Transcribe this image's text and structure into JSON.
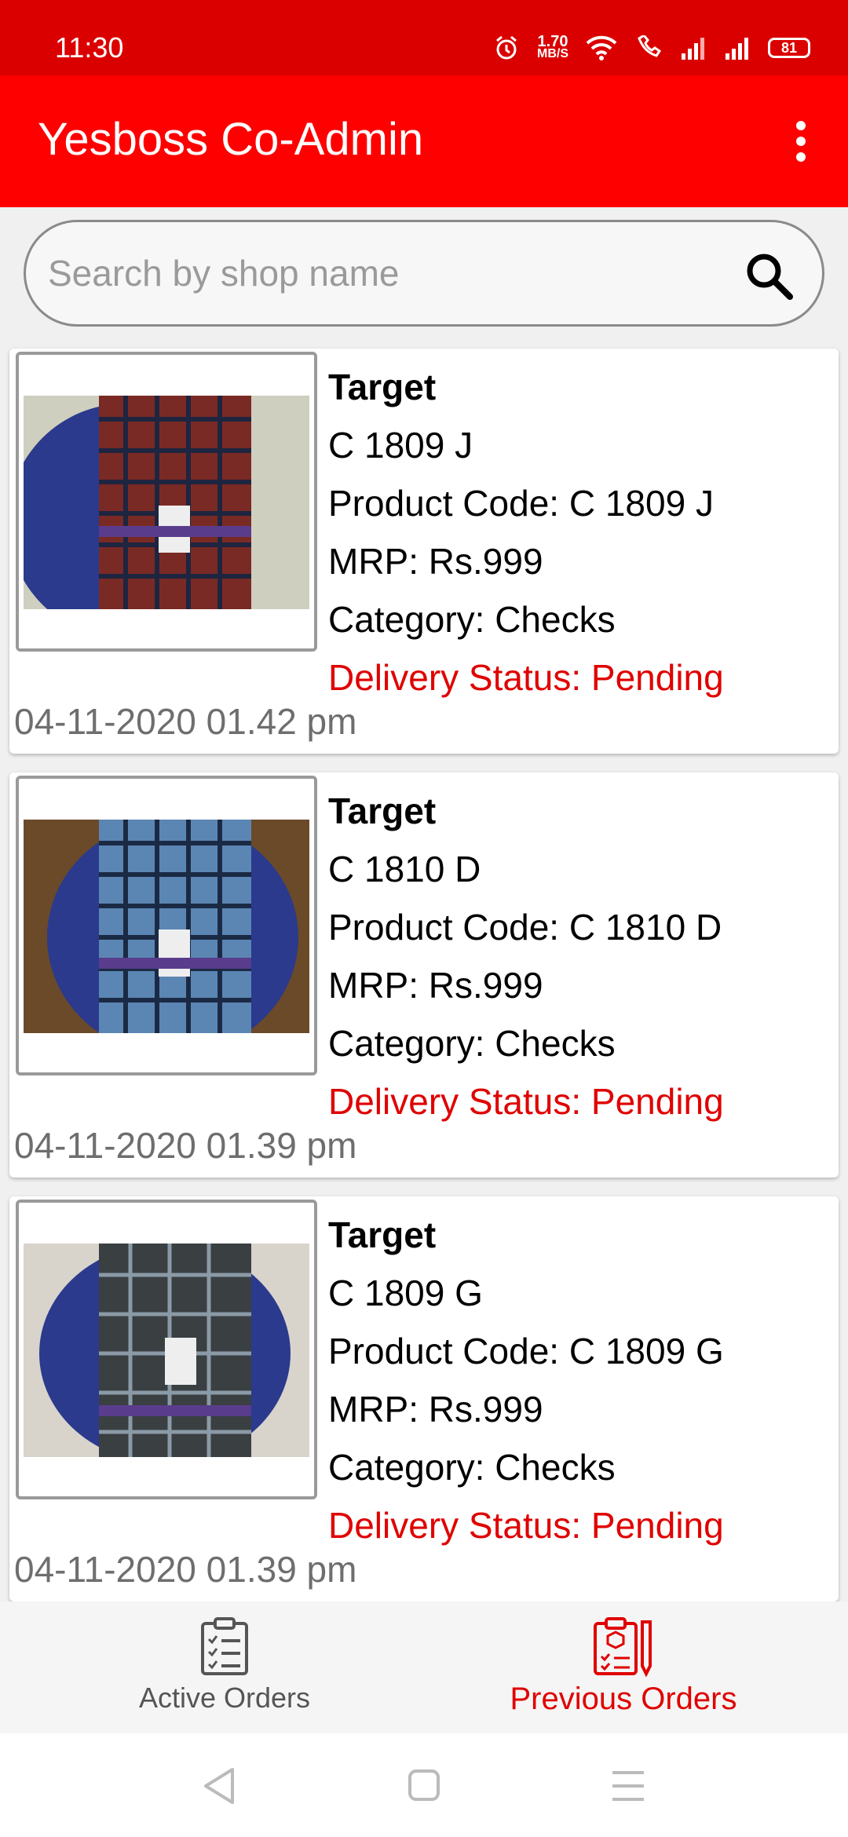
{
  "status_bar": {
    "time": "11:30",
    "net_speed": "1.70",
    "net_unit": "MB/S",
    "battery": "81"
  },
  "app_bar": {
    "title": "Yesboss Co-Admin"
  },
  "search": {
    "placeholder": "Search by shop name"
  },
  "orders": [
    {
      "shop": "Target",
      "name": "C 1809 J",
      "product_code": "Product Code: C 1809 J",
      "mrp": "MRP: Rs.999",
      "category": "Category: Checks",
      "status": "Delivery Status: Pending",
      "date": "04-11-2020 01.42 pm",
      "shirt_color": "#7a2a24",
      "check_color": "#1e2540"
    },
    {
      "shop": "Target",
      "name": "C 1810 D",
      "product_code": "Product Code: C 1810 D",
      "mrp": "MRP: Rs.999",
      "category": "Category: Checks",
      "status": "Delivery Status: Pending",
      "date": "04-11-2020 01.39 pm",
      "shirt_color": "#5b86b4",
      "check_color": "#1b2a44"
    },
    {
      "shop": "Target",
      "name": "C 1809 G",
      "product_code": "Product Code: C 1809 G",
      "mrp": "MRP: Rs.999",
      "category": "Category: Checks",
      "status": "Delivery Status: Pending",
      "date": "04-11-2020 01.39 pm",
      "shirt_color": "#3a3f42",
      "check_color": "#8a9aa6"
    }
  ],
  "bottom_nav": {
    "active_orders": "Active Orders",
    "previous_orders": "Previous Orders"
  },
  "colors": {
    "status_bar": "#db0000",
    "app_bar": "#ff0000",
    "accent": "#e00000"
  }
}
